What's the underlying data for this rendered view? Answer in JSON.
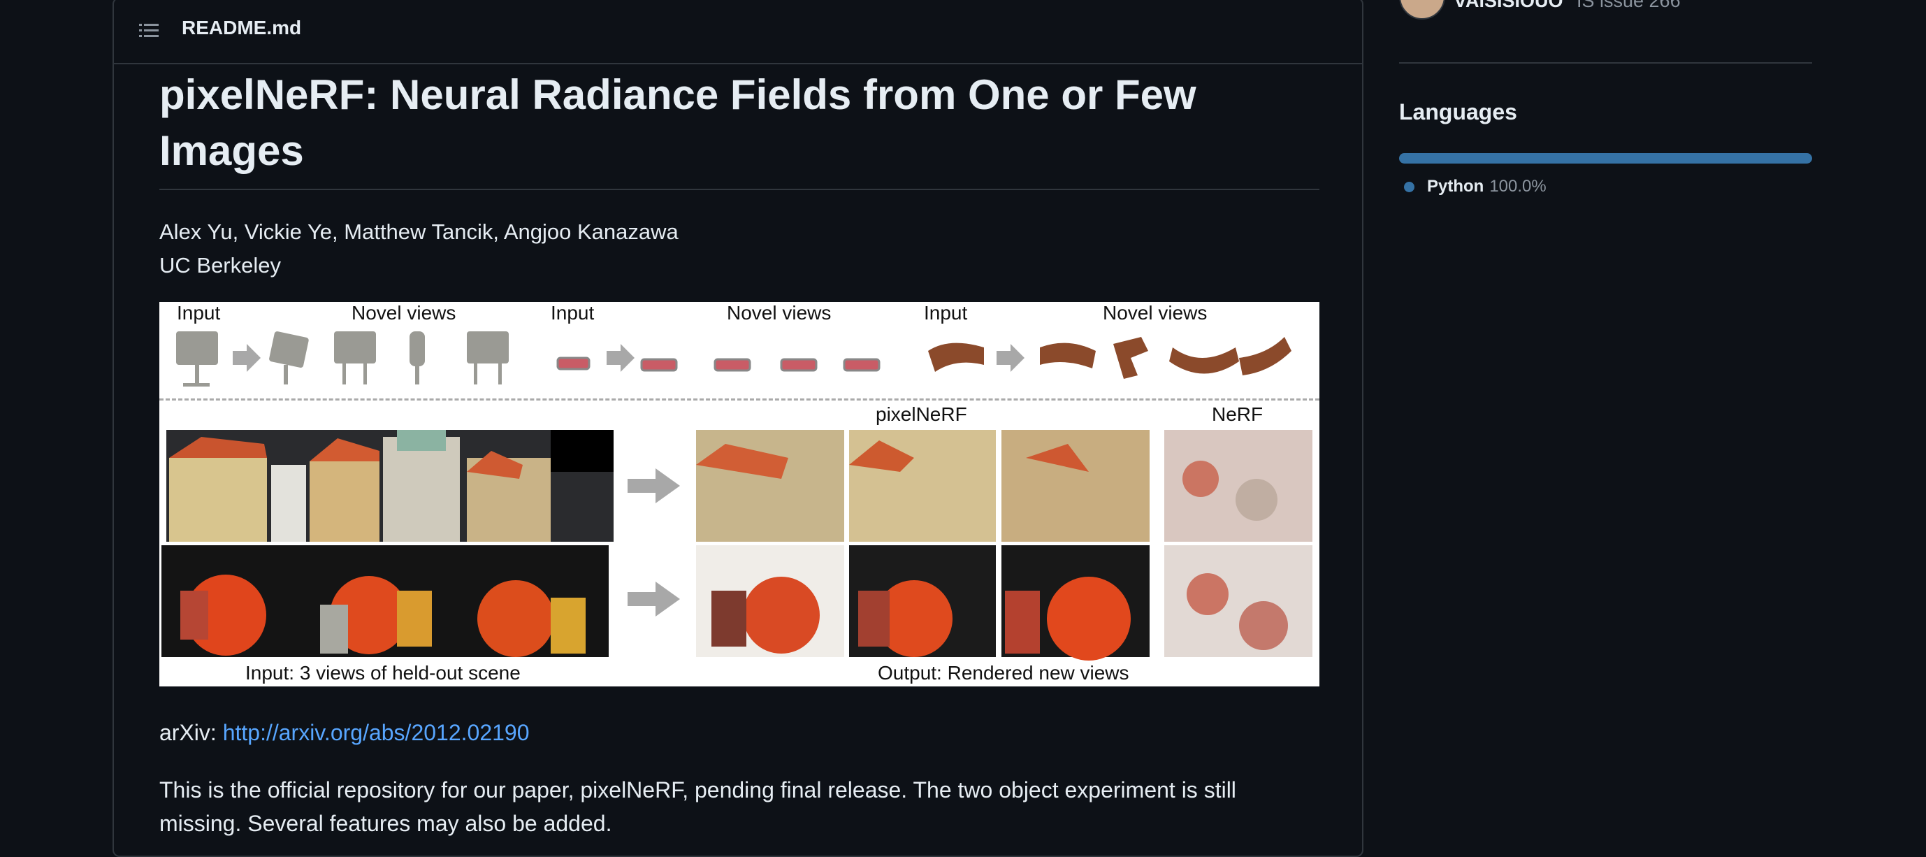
{
  "readme": {
    "filename": "README.md",
    "title": "pixelNeRF: Neural Radiance Fields from One or Few Images",
    "authors": "Alex Yu, Vickie Ye, Matthew Tancik, Angjoo Kanazawa",
    "affiliation": "UC Berkeley",
    "figure": {
      "top_labels": [
        "Input",
        "Novel views",
        "Input",
        "Novel views",
        "Input",
        "Novel views"
      ],
      "pixelnerf_label": "pixelNeRF",
      "nerf_label": "NeRF",
      "input_caption": "Input: 3 views of held-out scene",
      "output_caption": "Output: Rendered new views"
    },
    "arxiv_label": "arXiv:",
    "arxiv_link": "http://arxiv.org/abs/2012.02190",
    "description": "This is the official repository for our paper, pixelNeRF, pending final release. The two object experiment is still missing. Several features may also be added."
  },
  "sidebar": {
    "contributor_name": "vAlSISIOUO",
    "contributor_meta": "IS issue 266",
    "languages_title": "Languages",
    "languages": [
      {
        "name": "Python",
        "percent": "100.0%",
        "color": "#3572a5"
      }
    ]
  }
}
